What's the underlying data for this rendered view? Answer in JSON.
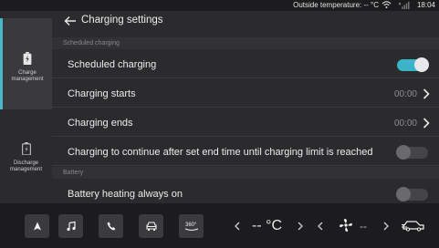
{
  "status": {
    "temperature": "Outside temperature: -- °C",
    "time": "18:04"
  },
  "side": {
    "tabs": [
      {
        "label": "Charge\nmanagement",
        "active": true
      },
      {
        "label": "Discharge\nmanagement",
        "active": false
      }
    ]
  },
  "header": {
    "title": "Charging settings"
  },
  "sections": {
    "scheduled": "Scheduled charging",
    "battery": "Battery"
  },
  "rows": {
    "scheduled_charging": {
      "label": "Scheduled charging",
      "toggle": "on"
    },
    "charging_starts": {
      "label": "Charging starts",
      "value": "00:00"
    },
    "charging_ends": {
      "label": "Charging ends",
      "value": "00:00"
    },
    "continue_after": {
      "label": "Charging to continue after set end time until charging limit is reached",
      "toggle": "off"
    },
    "battery_heating": {
      "label": "Battery heating always on",
      "toggle": "off"
    }
  },
  "bottom": {
    "cam_label": "360°",
    "temperature": "-- °C",
    "fan": "--"
  },
  "colors": {
    "accent": "#3ab4c6",
    "background": "#2b2b2d"
  }
}
